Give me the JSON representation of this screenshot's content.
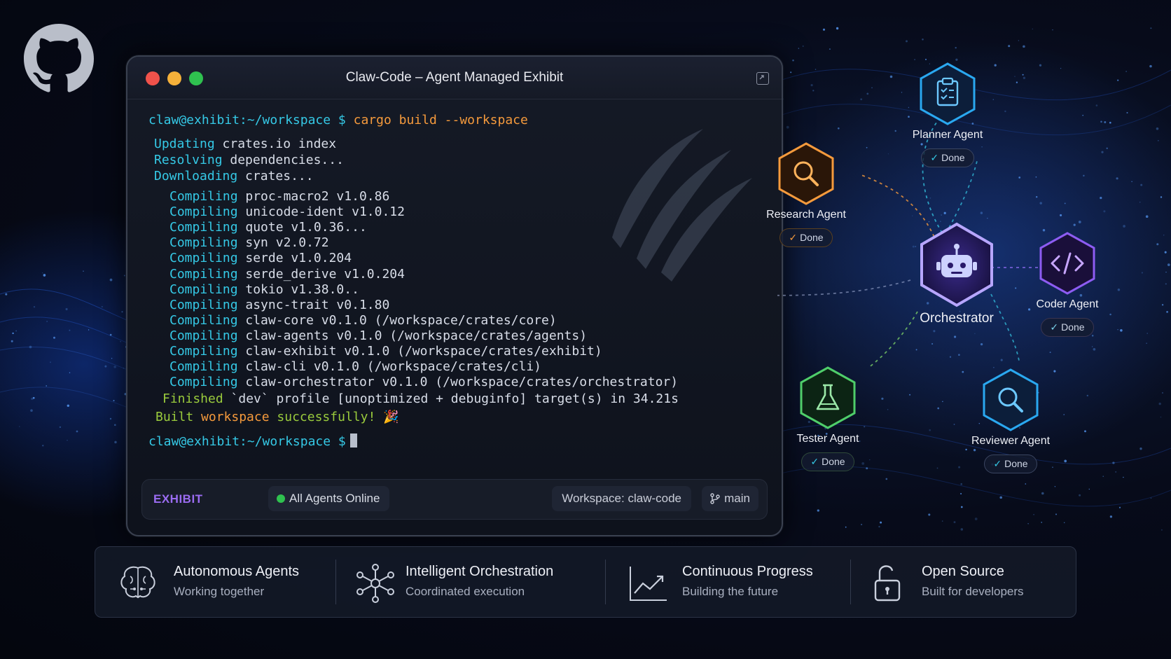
{
  "window": {
    "title": "Claw-Code – Agent Managed Exhibit"
  },
  "terminal": {
    "prompt": "claw@exhibit:~/workspace $",
    "command": "cargo build --workspace",
    "updating_label": "Updating",
    "updating_text": " crates.io index",
    "resolving_label": "Resolving",
    "resolving_text": " dependencies...",
    "downloading_label": "Downloading",
    "downloading_text": " crates...",
    "compile_label": "Compiling",
    "compiling": [
      " proc-macro2 v1.0.86",
      " unicode-ident v1.0.12",
      " quote v1.0.36...",
      " syn v2.0.72",
      " serde v1.0.204",
      " serde_derive v1.0.204",
      " tokio v1.38.0..",
      " async-trait v0.1.80",
      " claw-core v0.1.0 (/workspace/crates/core)",
      " claw-agents v0.1.0 (/workspace/crates/agents)",
      " claw-exhibit v0.1.0 (/workspace/crates/exhibit)",
      " claw-cli v0.1.0 (/workspace/crates/cli)",
      " claw-orchestrator v0.1.0 (/workspace/crates/orchestrator)"
    ],
    "finished_label": "Finished",
    "finished_text": " `dev` profile [unoptimized + debuginfo] target(s) in 34.21s",
    "built_a": "Built",
    "built_b": " workspace ",
    "built_c": "successfully!",
    "built_emoji": "🎉",
    "final_prompt": "claw@exhibit:~/workspace $"
  },
  "statusbar": {
    "brand": "EXHIBIT",
    "online": "All Agents Online",
    "workspace": "Workspace: claw-code",
    "branch": "main"
  },
  "agents": {
    "planner": {
      "name": "Planner Agent",
      "status": "Done"
    },
    "research": {
      "name": "Research Agent",
      "status": "Done"
    },
    "orchestrator": {
      "name": "Orchestrator"
    },
    "coder": {
      "name": "Coder Agent",
      "status": "Done"
    },
    "tester": {
      "name": "Tester Agent",
      "status": "Done"
    },
    "reviewer": {
      "name": "Reviewer Agent",
      "status": "Done"
    }
  },
  "features": [
    {
      "title": "Autonomous Agents",
      "subtitle": "Working together",
      "icon": "brain-icon"
    },
    {
      "title": "Intelligent Orchestration",
      "subtitle": "Coordinated execution",
      "icon": "network-icon"
    },
    {
      "title": "Continuous Progress",
      "subtitle": "Building the future",
      "icon": "chart-icon"
    },
    {
      "title": "Open Source",
      "subtitle": "Built for developers",
      "icon": "unlock-icon"
    }
  ],
  "colors": {
    "cyan": "#35c9e6",
    "orange": "#f59a3c",
    "green": "#9acb3c",
    "purple": "#9b6cf2",
    "online": "#2fc14f"
  }
}
